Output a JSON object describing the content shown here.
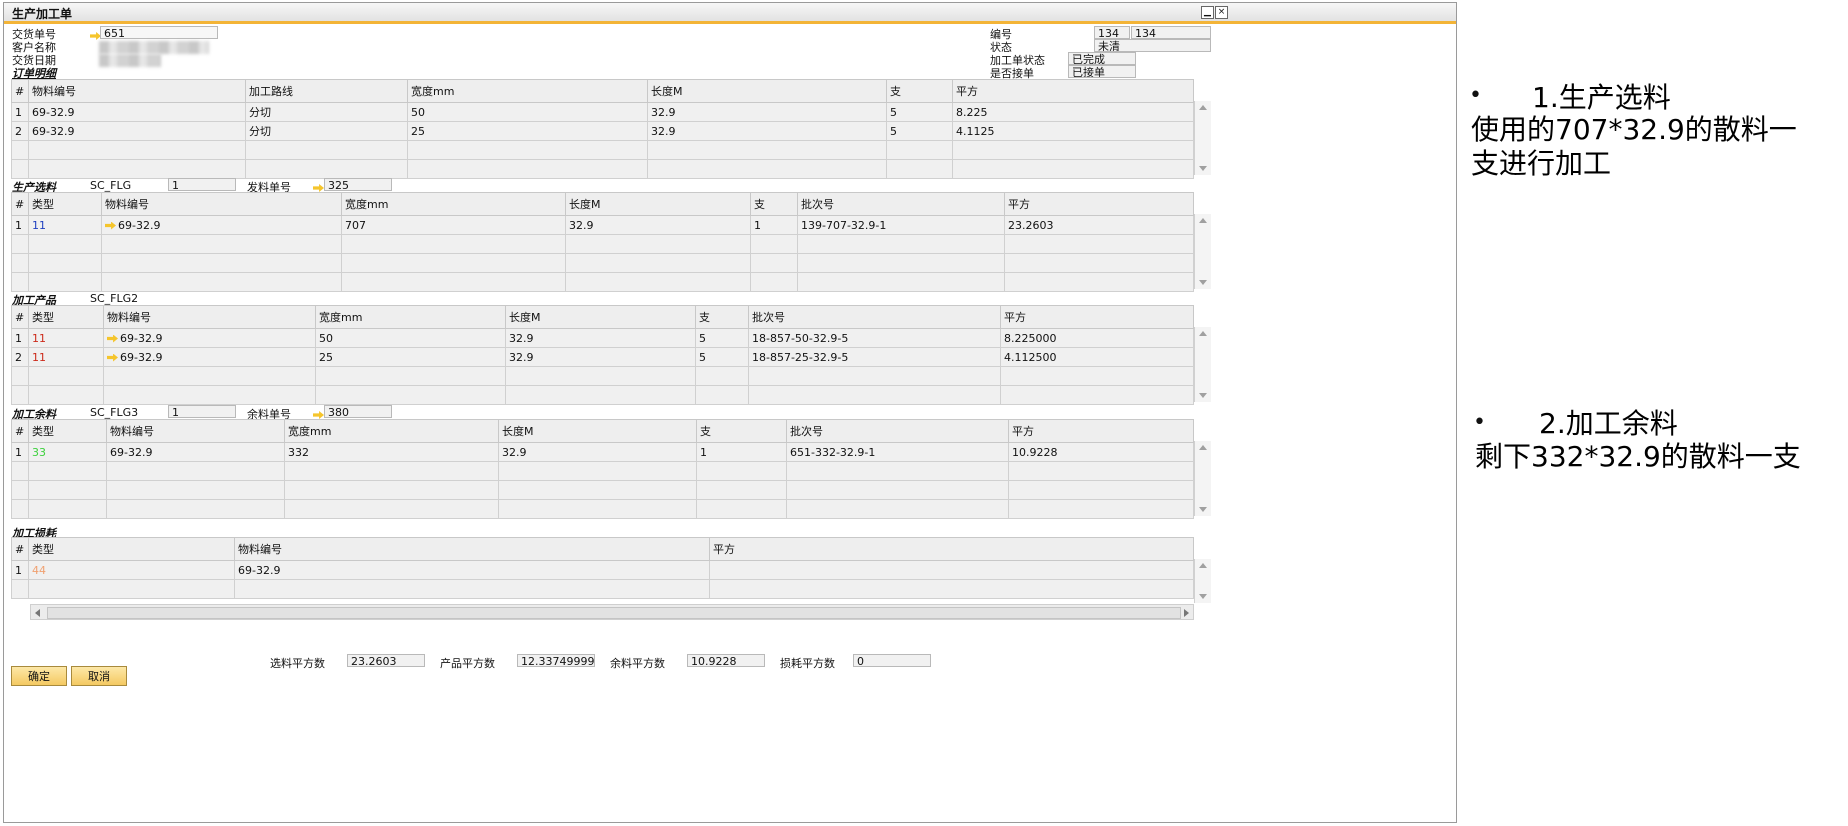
{
  "window": {
    "title": "生产加工单"
  },
  "header": {
    "delivery_no_label": "交货单号",
    "delivery_no_value": "651",
    "customer_label": "客户名称",
    "delivery_date_label": "交货日期",
    "order_detail_section": "订单明细",
    "code_label": "编号",
    "code_value1": "134",
    "code_value2": "134",
    "status_label": "状态",
    "status_value": "未清",
    "process_status_label": "加工单状态",
    "process_status_value": "已完成",
    "accepted_label": "是否接单",
    "accepted_value": "已接单"
  },
  "order_table": {
    "columns": [
      "#",
      "物料编号",
      "加工路线",
      "宽度mm",
      "长度M",
      "支",
      "平方"
    ],
    "rows": [
      [
        "1",
        "69-32.9",
        "分切",
        "50",
        "32.9",
        "5",
        "8.225"
      ],
      [
        "2",
        "69-32.9",
        "分切",
        "25",
        "32.9",
        "5",
        "4.1125"
      ]
    ]
  },
  "material_section": {
    "title": "生产选料",
    "code": "SC_FLG",
    "field": "1",
    "issue_label": "发料单号",
    "issue_value": "325",
    "columns": [
      "#",
      "类型",
      "物料编号",
      "宽度mm",
      "长度M",
      "支",
      "批次号",
      "平方"
    ],
    "rows": [
      [
        "1",
        "11",
        "69-32.9",
        "707",
        "32.9",
        "1",
        "139-707-32.9-1",
        "23.2603"
      ]
    ]
  },
  "product_section": {
    "title": "加工产品",
    "code": "SC_FLG2",
    "columns": [
      "#",
      "类型",
      "物料编号",
      "宽度mm",
      "长度M",
      "支",
      "批次号",
      "平方"
    ],
    "rows": [
      [
        "1",
        "11",
        "69-32.9",
        "50",
        "32.9",
        "5",
        "18-857-50-32.9-5",
        "8.225000"
      ],
      [
        "2",
        "11",
        "69-32.9",
        "25",
        "32.9",
        "5",
        "18-857-25-32.9-5",
        "4.112500"
      ]
    ]
  },
  "remnant_section": {
    "title": "加工余料",
    "code": "SC_FLG3",
    "field": "1",
    "remnant_label": "余料单号",
    "remnant_value": "380",
    "columns": [
      "#",
      "类型",
      "物料编号",
      "宽度mm",
      "长度M",
      "支",
      "批次号",
      "平方"
    ],
    "rows": [
      [
        "1",
        "33",
        "69-32.9",
        "332",
        "32.9",
        "1",
        "651-332-32.9-1",
        "10.9228"
      ]
    ]
  },
  "loss_section": {
    "title": "加工损耗",
    "columns": [
      "#",
      "类型",
      "物料编号",
      "平方"
    ],
    "rows": [
      [
        "1",
        "44",
        "69-32.9",
        ""
      ]
    ]
  },
  "totals": {
    "selected_label": "选料平方数",
    "selected_value": "23.2603",
    "product_label": "产品平方数",
    "product_value": "12.33749999999",
    "remnant_label": "余料平方数",
    "remnant_value": "10.9228",
    "loss_label": "损耗平方数",
    "loss_value": "0"
  },
  "buttons": {
    "ok": "确定",
    "cancel": "取消"
  },
  "colors": {
    "type_material": "#1f3fbf",
    "type_product": "#cc2a1a",
    "type_remnant": "#3dd13d",
    "type_loss": "#f0a070",
    "accent": "#f3b437"
  },
  "notes": {
    "n1_title": "1.生产选料",
    "n1_line1": "使用的707*32.9的散料一",
    "n1_line2": "支进行加工",
    "n2_title": "2.加工余料",
    "n2_line1": "剩下332*32.9的散料一支"
  }
}
